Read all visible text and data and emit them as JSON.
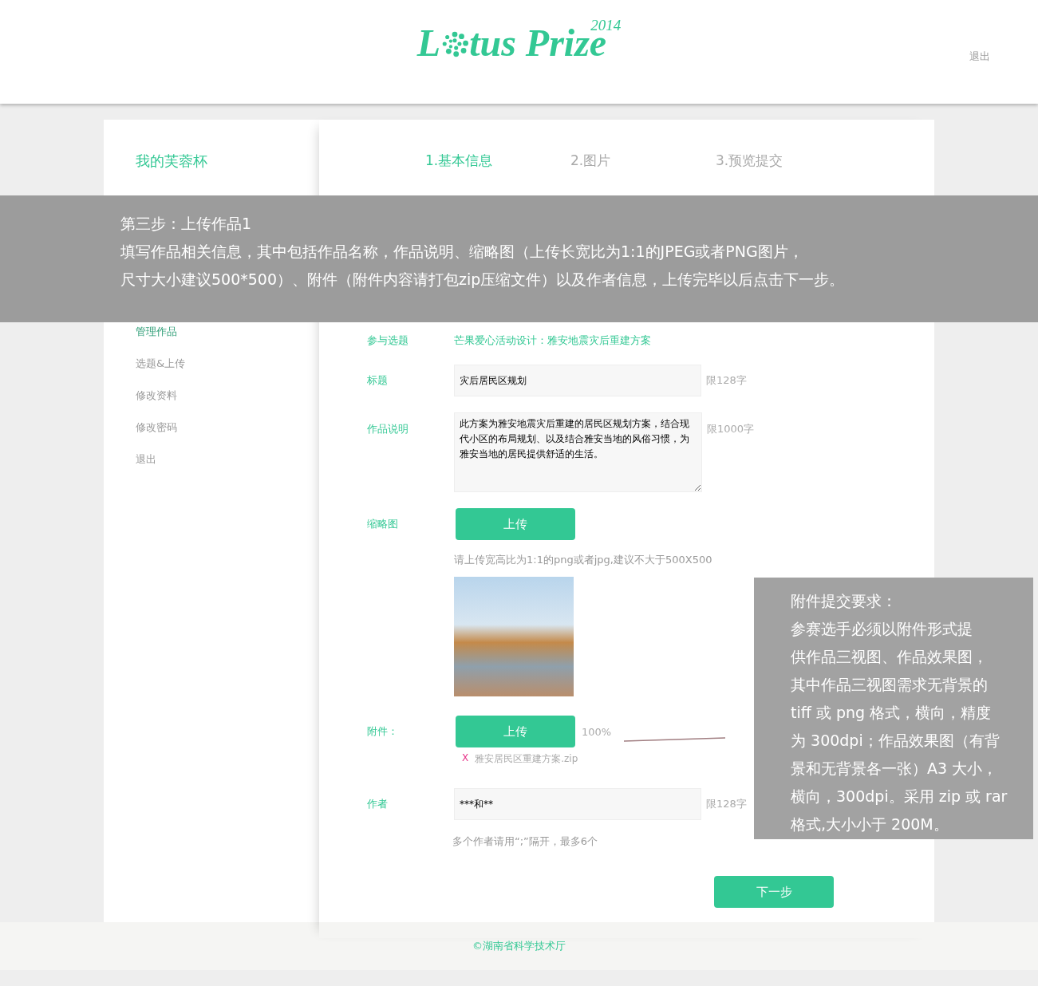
{
  "header": {
    "logo": {
      "before": "L",
      "after": "tus Prize",
      "year": "2014"
    },
    "logout": "退出"
  },
  "sidebar": {
    "title": "我的芙蓉杯",
    "items": [
      {
        "label": "管理作品",
        "selected": true
      },
      {
        "label": "选题&上传",
        "selected": false
      },
      {
        "label": "修改资料",
        "selected": false
      },
      {
        "label": "修改密码",
        "selected": false
      },
      {
        "label": "退出",
        "selected": false
      }
    ]
  },
  "steps": [
    {
      "label": "1.基本信息",
      "selected": true
    },
    {
      "label": "2.图片",
      "selected": false
    },
    {
      "label": "3.预览提交",
      "selected": false
    }
  ],
  "form": {
    "topic": {
      "label": "参与选题",
      "value": "芒果爱心活动设计：雅安地震灾后重建方案"
    },
    "title": {
      "label": "标题",
      "value": "灾后居民区规划",
      "limit": "限128字"
    },
    "description": {
      "label": "作品说明",
      "value": "此方案为雅安地震灾后重建的居民区规划方案，结合现代小区的布局规划、以及结合雅安当地的风俗习惯，为雅安当地的居民提供舒适的生活。",
      "limit": "限1000字"
    },
    "thumbnail": {
      "label": "缩略图",
      "button": "上传",
      "hint": "请上传宽高比为1:1的png或者jpg,建议不大于500X500"
    },
    "attachment": {
      "label": "附件：",
      "button": "上传",
      "progress": "100%",
      "remove": "X",
      "file": "雅安居民区重建方案.zip"
    },
    "author": {
      "label": "作者",
      "value": "***和**",
      "limit": "限128字",
      "hint": "多个作者请用“;”隔开，最多6个"
    },
    "next": "下一步"
  },
  "footer": "©湖南省科学技术厅",
  "guide_banner": {
    "title": "第三步：上传作品1",
    "lines": [
      "填写作品相关信息，其中包括作品名称，作品说明、缩略图（上传长宽比为1:1的JPEG或者PNG图片，",
      "尺寸大小建议500*500）、附件（附件内容请打包zip压缩文件）以及作者信息，上传完毕以后点击下一步。"
    ]
  },
  "attachment_note": {
    "lines": [
      "附件提交要求：",
      "参赛选手必须以附件形式提",
      "供作品三视图、作品效果图，",
      "其中作品三视图需求无背景的",
      "tiff 或 png 格式，横向，精度",
      "为 300dpi；作品效果图（有背",
      "景和无背景各一张）A3 大小，",
      "横向，300dpi。采用 zip 或 rar",
      "格式,大小小于 200M。"
    ]
  }
}
